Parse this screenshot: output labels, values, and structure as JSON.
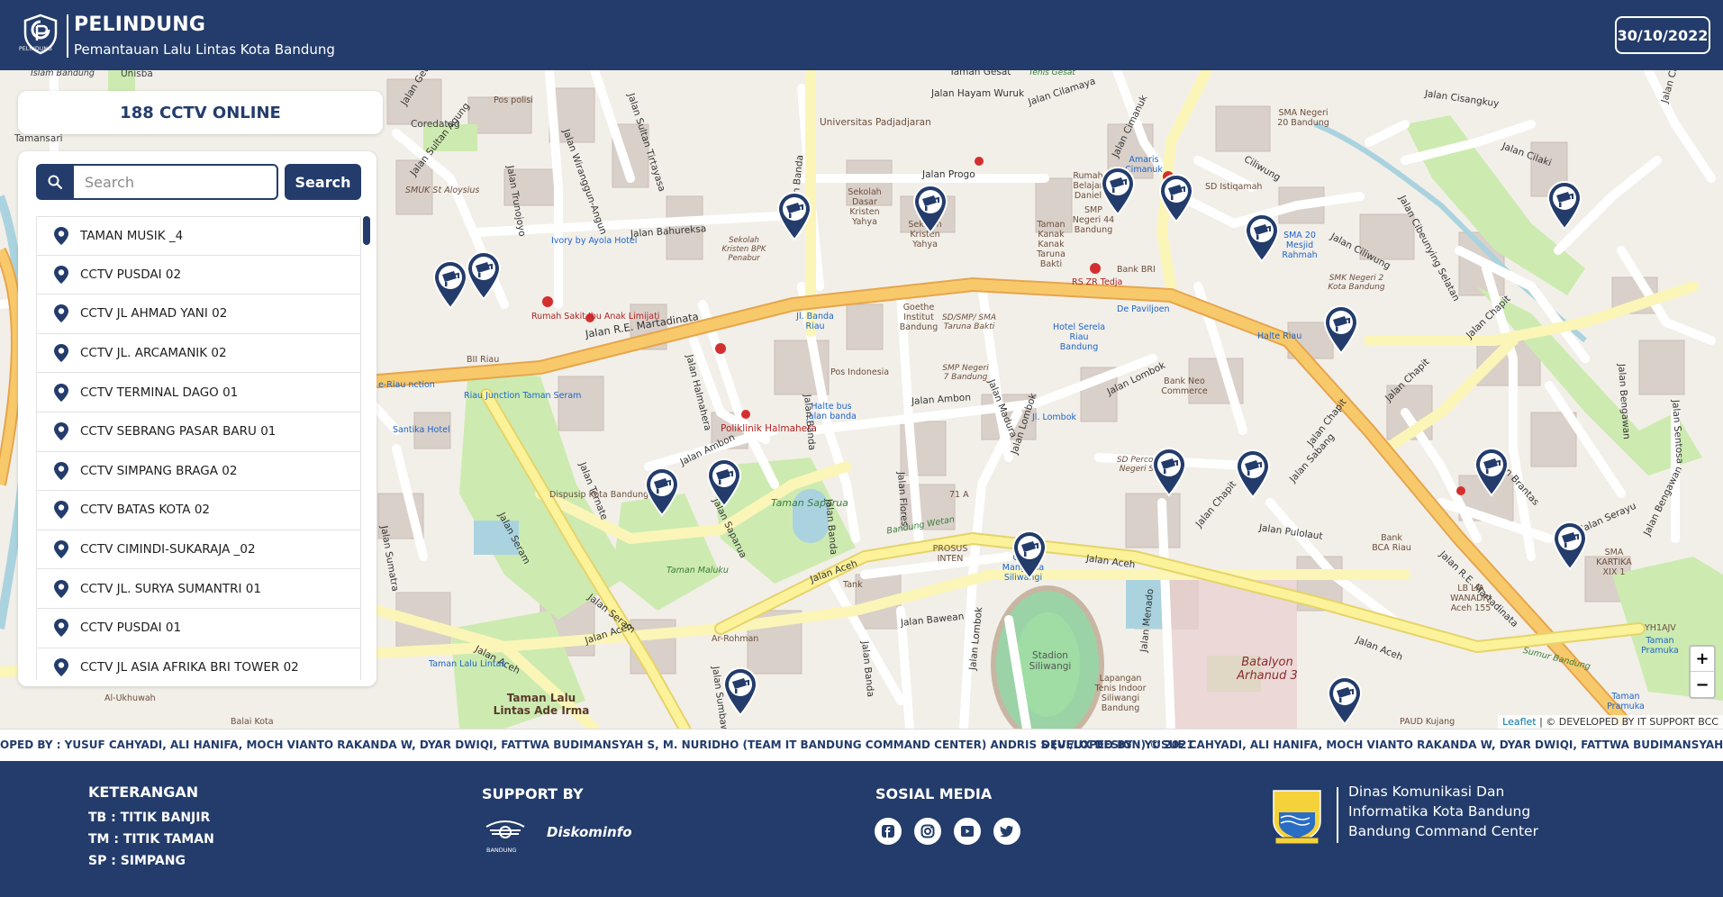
{
  "header": {
    "title": "PELINDUNG",
    "subtitle": "Pemantauan Lalu Lintas Kota Bandung",
    "logo_caption": "PELINDUNG",
    "date": "30/10/2022"
  },
  "sidebar": {
    "online_count_label": "188 CCTV ONLINE",
    "search_placeholder": "Search",
    "search_button": "Search",
    "cctv_list": [
      "TAMAN MUSIK _4",
      "CCTV PUSDAI 02",
      "CCTV JL AHMAD YANI 02",
      "CCTV JL. ARCAMANIK 02",
      "CCTV TERMINAL DAGO 01",
      "CCTV SEBRANG PASAR BARU 01",
      "CCTV SIMPANG BRAGA 02",
      "CCTV BATAS KOTA 02",
      "CCTV CIMINDI-SUKARAJA _02",
      "CCTV JL. SURYA SUMANTRI 01",
      "CCTV PUSDAI 01",
      "CCTV JL ASIA AFRIKA BRI TOWER 02"
    ]
  },
  "map": {
    "labels": {
      "islam_bandung": "Islam Bandung",
      "unisba": "Unisba",
      "tamansari": "Tamansari",
      "pos_polisi": "Pos polisi",
      "coredatag": "Coredatag",
      "jalan_geusan_ulun": "Jalan Geusan Ulun",
      "jalan_sultan_agung": "Jalan Sultan Agung",
      "jalan_trunojoyo": "Jalan Trunojoyo",
      "jalan_wiranggunangun": "Jalan Wiranggun-Angun",
      "jalan_sultan_tirtayasa": "Jalan Sultan Tirtayasa",
      "smuk": "SMUK St Aloysius",
      "ivory": "Ivory by Ayola Hotel",
      "jalan_bahureksa": "Jalan Bahureksa",
      "rumah_sakit": "Rumah Sakit Ibu Anak Limijati",
      "jalan_re_martadinata": "Jalan R.E. Martadinata",
      "bii_riau": "BII Riau",
      "riau_junction": "Riau Junction Taman Seram",
      "santika": "Santika Hotel",
      "riau_left": "e-Riau nction",
      "jalan_sumatra": "Jalan Sumatra",
      "jalan_seram": "Jalan Seram",
      "jalan_ternate": "Jalan Ternate",
      "disnusip": "Dispusip Kota Bandung",
      "taman_maluku": "Taman Maluku",
      "jalan_aceh": "Jalan Aceh",
      "ar_rohman": "Ar-Rohman",
      "jalan_sumbawa": "Jalan Sumbawa",
      "taman_lalu_lintas_small": "Taman Lalu Lintas",
      "taman_lalu_lintas_big": "Taman Lalu Lintas Ade Irma",
      "al_ukhuwah": "Al-Ukhuwah",
      "balai_kota": "Balai Kota",
      "jalan_halmahera": "Jalan Halmahera",
      "poliklinik": "Poliklinik Halmahera",
      "jalan_ambon": "Jalan Ambon",
      "taman_saparua": "Taman Saparua",
      "jalan_saparua": "Jalan Saparua",
      "taman_gesat": "Taman Gesat",
      "tenis_gesat": "Tenis Gesat",
      "jalan_hayam_wuruk": "Jalan Hayam Wuruk",
      "jalan_cilamaya": "Jalan Cilamaya",
      "unpad": "Universitas Padjadjaran",
      "jalan_banda": "Jalan Banda",
      "jalan_progo": "Jalan Progo",
      "sekolah_dasar": "Sekolah Dasar Kristen Yahya",
      "sekolah_kristen": "Sekolah Kristen Yahya",
      "sekolah_bpk": "Sekolah Kristen BPK Penabur",
      "goethe": "Goethe Institut Bandung",
      "sd_smp": "SD/SMP/ SMA Taruna Bakti",
      "smp7": "SMP Negeri 7 Bandung",
      "pos_indonesia": "Pos Indonesia",
      "halte_bus": "Halte bus jalan banda",
      "jl_banda_riau": "Jl. Banda Riau",
      "jalan_flores": "Jalan Flores",
      "jalan_madura": "Jalan Madura",
      "jalan_lombok": "Jalan Lombok",
      "jl_lombok": "Jl. Lombok",
      "hotel_serela": "Hotel Serela Riau Bandung",
      "rs_zr": "RS ZR Tedja",
      "de_paviljoen": "De Paviljoen",
      "bank_bri": "Bank BRI",
      "taman_kanak": "Taman Kanak Kanak Taruna Bakti",
      "rumah_belajar": "Rumah Belajar Daniel",
      "smp44": "SMP Negeri 44 Bandung",
      "amaris": "Amaris Cimanuk",
      "jalan_cimanuk": "Jalan Cimanuk",
      "sd_istiqamah": "SD Istiqamah",
      "ciliwung": "Ciliwung",
      "sma_negeri20": "SMA Negeri 20 Bandung",
      "jalan_cisangkuy": "Jalan Cisangkuy",
      "jalan_cilaki": "Jalan Cilaki",
      "jalan_cipunagara": "Jalan Cipunagara",
      "sma20_mesjid": "SMA 20 Mesjid Rahmah",
      "jalan_ciliwung": "Jalan Ciliwung",
      "jalan_cibeunying": "Jalan Cibeunying Selatan",
      "smk_negeri2": "SMK Negeri 2 Kota Bandung",
      "halte_riau": "Halte Riau",
      "jalan_chapit": "Jalan Chapit",
      "jalan_bengawan": "Jalan Bengawan",
      "jalan_sentosa": "Jalan Sentosa",
      "bank_neo": "Bank Neo Commerce",
      "sd_percontohan": "SD Percontohan Negeri Sabang",
      "jalan_sabang": "Jalan Sabang",
      "jalan_pulolaut": "Jalan Pulolaut",
      "jalan_brantas": "Jalan Brantas",
      "bank_bca": "Bank BCA Riau",
      "jalan_serayu": "Jalan Serayu",
      "sma_kartika": "SMA KARTIKA XIX 1",
      "lb_lia": "LB LIA WANADRI Aceh 155",
      "yhiajv": "YH1AJV",
      "taman_pramuka_small": "Taman Pramuka",
      "taman_pramuka": "Taman Pramuka",
      "sumur_bandung": "Sumur Bandung",
      "paud_kujang": "PAUD Kujang",
      "batalyon": "Batalyon Arhanud 3",
      "jalan_menado": "Jalan Menado",
      "stadion": "Stadion Siliwangi",
      "lapangan_tenis": "Lapangan Tenis Indoor Siliwangi Bandung",
      "jalan_bawean": "Jalan Bawean",
      "prosus_inten": "PROSUS INTEN",
      "grha_manggala": "Grha Manggala Siliwangi",
      "bandung_wetan": "Bandung Wetan",
      "tank": "Tank",
      "ha_71a": "71 A"
    },
    "zoom_in": "+",
    "zoom_out": "−",
    "attribution_leaflet": "Leaflet",
    "attribution_text": "| © DEVELOPED BY IT SUPPORT BCC"
  },
  "marquee": {
    "text_left": "OPED BY : YUSUF CAHYADI, ALI HANIFA, MOCH VIANTO RAKANDA W, DYAR DWIQI, FATTWA BUDIMANSYAH S, M. NURIDHO (TEAM IT BANDUNG COMMAND CENTER) ANDRIS S (UI/UX DESIGN) © 2021",
    "text_right": "DEVELOPED BY : YUSUF CAHYADI, ALI HANIFA, MOCH VIANTO RAKANDA W, DYAR DWIQI, FATTWA BUDIMANSYAH S, M. NURIDHO (TEA"
  },
  "footer": {
    "keterangan_title": "KETERANGAN",
    "keterangan_items": [
      "TB : TITIK BANJIR",
      "TM : TITIK TAMAN",
      "SP : SIMPANG"
    ],
    "support_title": "SUPPORT BY",
    "support_logo1_caption": "BANDUNG",
    "support_logo2": "Diskominfo",
    "social_title": "SOSIAL MEDIA",
    "social_icons": [
      "facebook-icon",
      "instagram-icon",
      "youtube-icon",
      "twitter-icon"
    ],
    "dinas_lines": [
      "Dinas Komunikasi Dan",
      "Informatika Kota Bandung",
      "Bandung Command Center"
    ]
  },
  "colors": {
    "primary": "#233c6b",
    "primary_road": "#f7c96a",
    "secondary_road": "#fbf5b8",
    "park": "#cdebb0",
    "building": "#d9d0c9"
  }
}
